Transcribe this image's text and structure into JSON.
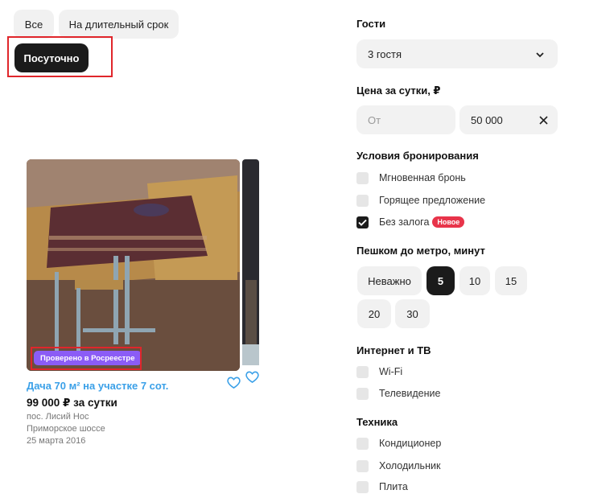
{
  "rent_tabs": {
    "all": "Все",
    "long_term": "На длительный срок",
    "daily": "Посуточно"
  },
  "listing": {
    "badge": "Проверено в Росреестре",
    "title": "Дача 70 м² на участке 7 сот.",
    "price": "99 000 ₽ за сутки",
    "address_line1": "пос. Лисий Нос",
    "address_line2": "Приморское шоссе",
    "date": "25 марта 2016"
  },
  "filters": {
    "guests": {
      "label": "Гости",
      "value": "3 гостя"
    },
    "price": {
      "label": "Цена за сутки, ₽",
      "from_placeholder": "От",
      "to_value": "50 000"
    },
    "booking": {
      "label": "Условия бронирования",
      "options": [
        {
          "label": "Мгновенная бронь",
          "checked": false
        },
        {
          "label": "Горящее предложение",
          "checked": false
        },
        {
          "label": "Без залога",
          "checked": true,
          "badge": "Новое"
        }
      ]
    },
    "metro": {
      "label": "Пешком до метро, минут",
      "options": [
        "Неважно",
        "5",
        "10",
        "15",
        "20",
        "30"
      ],
      "selected": "5"
    },
    "internet": {
      "label": "Интернет и ТВ",
      "options": [
        {
          "label": "Wi-Fi",
          "checked": false
        },
        {
          "label": "Телевидение",
          "checked": false
        }
      ]
    },
    "appliances": {
      "label": "Техника",
      "options": [
        {
          "label": "Кондиционер",
          "checked": false
        },
        {
          "label": "Холодильник",
          "checked": false
        },
        {
          "label": "Плита",
          "checked": false
        }
      ]
    }
  },
  "colors": {
    "accent_link": "#3aa0e8",
    "verified_badge": "#8b5cf6",
    "new_badge": "#e8344a",
    "highlight_box": "#e0262b"
  }
}
